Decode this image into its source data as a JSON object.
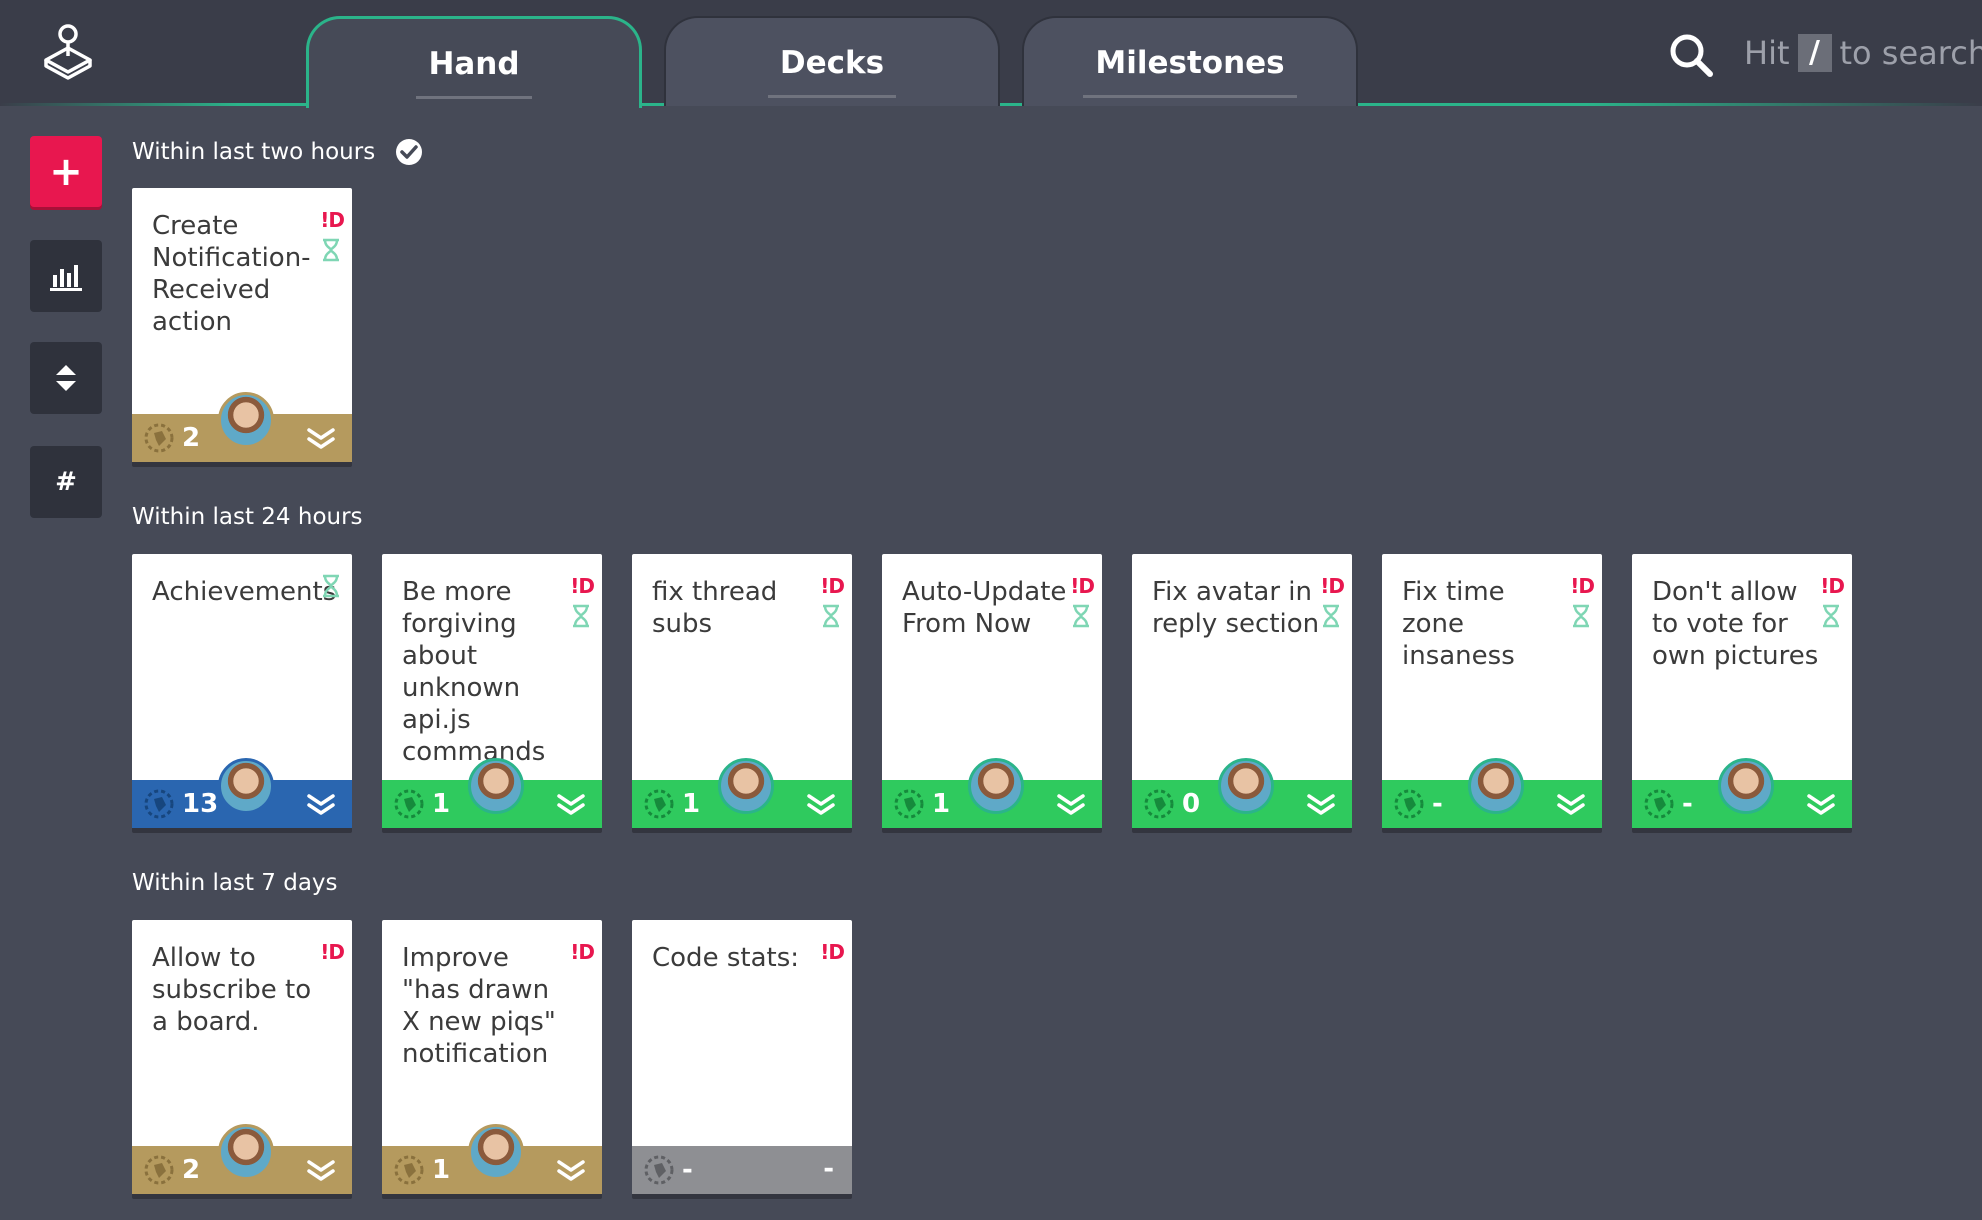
{
  "tabs": [
    {
      "label": "Hand",
      "active": true
    },
    {
      "label": "Decks",
      "active": false
    },
    {
      "label": "Milestones",
      "active": false
    }
  ],
  "search": {
    "hint_prefix": "Hit",
    "key": "/",
    "hint_suffix": "to search"
  },
  "sidebar": [
    {
      "name": "add",
      "icon": "plus-icon",
      "glyph": "+"
    },
    {
      "name": "stats",
      "icon": "bar-chart-icon"
    },
    {
      "name": "sort",
      "icon": "sort-arrows-icon"
    },
    {
      "name": "tags",
      "icon": "hash-icon",
      "glyph": "#"
    }
  ],
  "sections": [
    {
      "title": "Within last two hours",
      "done_icon": "check-circle-icon",
      "cards": [
        {
          "title": "Create Notification-Received action",
          "flag": "!D",
          "hourglass": true,
          "points": "2",
          "footer": "gold"
        }
      ]
    },
    {
      "title": "Within last 24 hours",
      "cards": [
        {
          "title": "Achievements",
          "flag": "",
          "hourglass": true,
          "points": "13",
          "footer": "blue"
        },
        {
          "title": "Be more forgiving about unknown api.js commands",
          "flag": "!D",
          "hourglass": true,
          "points": "1",
          "footer": "green"
        },
        {
          "title": "fix thread subs",
          "flag": "!D",
          "hourglass": true,
          "points": "1",
          "footer": "green"
        },
        {
          "title": "Auto-Update From Now",
          "flag": "!D",
          "hourglass": true,
          "points": "1",
          "footer": "green"
        },
        {
          "title": "Fix avatar in reply section",
          "flag": "!D",
          "hourglass": true,
          "points": "0",
          "footer": "green"
        },
        {
          "title": "Fix time zone insaness",
          "flag": "!D",
          "hourglass": true,
          "points": "-",
          "footer": "green"
        },
        {
          "title": "Don't allow to vote for own pictures",
          "flag": "!D",
          "hourglass": true,
          "points": "-",
          "footer": "green"
        }
      ]
    },
    {
      "title": "Within last 7 days",
      "cards": [
        {
          "title": "Allow to subscribe to a board.",
          "flag": "!D",
          "hourglass": false,
          "points": "2",
          "footer": "gold"
        },
        {
          "title": "Improve \"has drawn X new piqs\" notification",
          "flag": "!D",
          "hourglass": false,
          "points": "1",
          "footer": "gold"
        },
        {
          "title": "Code stats:",
          "flag": "!D",
          "hourglass": false,
          "points": "-",
          "footer": "gray",
          "right_text": "-"
        }
      ]
    }
  ],
  "colors": {
    "accent": "#2bb48a",
    "danger": "#e8174f",
    "gold": "#b59a5e",
    "green": "#2fca5e",
    "blue": "#2a66b0",
    "gray": "#8e8f93"
  }
}
